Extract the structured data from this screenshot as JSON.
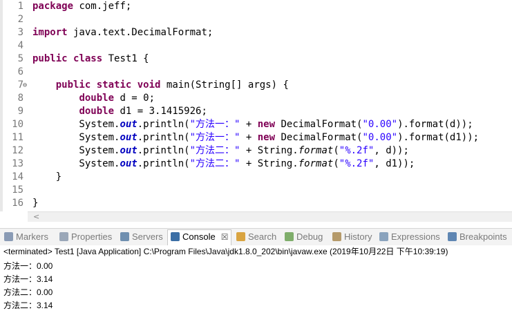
{
  "editor": {
    "lines": [
      {
        "n": "1",
        "tokens": [
          {
            "t": "package",
            "c": "kw"
          },
          {
            "t": " com.jeff;",
            "c": ""
          }
        ]
      },
      {
        "n": "2",
        "tokens": []
      },
      {
        "n": "3",
        "tokens": [
          {
            "t": "import",
            "c": "kw"
          },
          {
            "t": " java.text.DecimalFormat;",
            "c": ""
          }
        ]
      },
      {
        "n": "4",
        "tokens": []
      },
      {
        "n": "5",
        "tokens": [
          {
            "t": "public",
            "c": "kw"
          },
          {
            "t": " ",
            "c": ""
          },
          {
            "t": "class",
            "c": "kw"
          },
          {
            "t": " Test1 {",
            "c": ""
          }
        ]
      },
      {
        "n": "6",
        "tokens": []
      },
      {
        "n": "7",
        "fold": "⊖",
        "tokens": [
          {
            "t": "    ",
            "c": ""
          },
          {
            "t": "public",
            "c": "kw"
          },
          {
            "t": " ",
            "c": ""
          },
          {
            "t": "static",
            "c": "kw"
          },
          {
            "t": " ",
            "c": ""
          },
          {
            "t": "void",
            "c": "kw"
          },
          {
            "t": " main(String[] args) {",
            "c": ""
          }
        ]
      },
      {
        "n": "8",
        "tokens": [
          {
            "t": "        ",
            "c": ""
          },
          {
            "t": "double",
            "c": "kw"
          },
          {
            "t": " d = 0;",
            "c": ""
          }
        ]
      },
      {
        "n": "9",
        "tokens": [
          {
            "t": "        ",
            "c": ""
          },
          {
            "t": "double",
            "c": "kw"
          },
          {
            "t": " d1 = 3.1415926;",
            "c": ""
          }
        ]
      },
      {
        "n": "10",
        "tokens": [
          {
            "t": "        System.",
            "c": ""
          },
          {
            "t": "out",
            "c": "fld"
          },
          {
            "t": ".println(",
            "c": ""
          },
          {
            "t": "\"方法一：\"",
            "c": "str"
          },
          {
            "t": " + ",
            "c": ""
          },
          {
            "t": "new",
            "c": "kw"
          },
          {
            "t": " DecimalFormat(",
            "c": ""
          },
          {
            "t": "\"0.00\"",
            "c": "str"
          },
          {
            "t": ").format(d));",
            "c": ""
          }
        ]
      },
      {
        "n": "11",
        "tokens": [
          {
            "t": "        System.",
            "c": ""
          },
          {
            "t": "out",
            "c": "fld"
          },
          {
            "t": ".println(",
            "c": ""
          },
          {
            "t": "\"方法一：\"",
            "c": "str"
          },
          {
            "t": " + ",
            "c": ""
          },
          {
            "t": "new",
            "c": "kw"
          },
          {
            "t": " DecimalFormat(",
            "c": ""
          },
          {
            "t": "\"0.00\"",
            "c": "str"
          },
          {
            "t": ").format(d1));",
            "c": ""
          }
        ]
      },
      {
        "n": "12",
        "tokens": [
          {
            "t": "        System.",
            "c": ""
          },
          {
            "t": "out",
            "c": "fld"
          },
          {
            "t": ".println(",
            "c": ""
          },
          {
            "t": "\"方法二：\"",
            "c": "str"
          },
          {
            "t": " + String.",
            "c": ""
          },
          {
            "t": "format",
            "c": "st"
          },
          {
            "t": "(",
            "c": ""
          },
          {
            "t": "\"%.2f\"",
            "c": "str"
          },
          {
            "t": ", d));",
            "c": ""
          }
        ]
      },
      {
        "n": "13",
        "tokens": [
          {
            "t": "        System.",
            "c": ""
          },
          {
            "t": "out",
            "c": "fld"
          },
          {
            "t": ".println(",
            "c": ""
          },
          {
            "t": "\"方法二：\"",
            "c": "str"
          },
          {
            "t": " + String.",
            "c": ""
          },
          {
            "t": "format",
            "c": "st"
          },
          {
            "t": "(",
            "c": ""
          },
          {
            "t": "\"%.2f\"",
            "c": "str"
          },
          {
            "t": ", d1));",
            "c": ""
          }
        ]
      },
      {
        "n": "14",
        "tokens": [
          {
            "t": "    }",
            "c": ""
          }
        ]
      },
      {
        "n": "15",
        "tokens": []
      },
      {
        "n": "16",
        "tokens": [
          {
            "t": "}",
            "c": ""
          }
        ]
      }
    ],
    "scroll_arrow": "<"
  },
  "tabs": [
    {
      "label": "Markers",
      "icon": "markers-icon",
      "color": "#8a9bb5"
    },
    {
      "label": "Properties",
      "icon": "properties-icon",
      "color": "#9aa7b8"
    },
    {
      "label": "Servers",
      "icon": "servers-icon",
      "color": "#6f8fb0"
    },
    {
      "label": "Console",
      "icon": "console-icon",
      "color": "#3b6ea5",
      "active": true
    },
    {
      "label": "Search",
      "icon": "search-icon",
      "color": "#d9a441"
    },
    {
      "label": "Debug",
      "icon": "debug-icon",
      "color": "#7fae6b"
    },
    {
      "label": "History",
      "icon": "history-icon",
      "color": "#b59a6a"
    },
    {
      "label": "Expressions",
      "icon": "expressions-icon",
      "color": "#8aa3bd"
    },
    {
      "label": "Breakpoints",
      "icon": "breakpoints-icon",
      "color": "#5f86b3"
    }
  ],
  "console": {
    "header": "<terminated> Test1 [Java Application] C:\\Program Files\\Java\\jdk1.8.0_202\\bin\\javaw.exe (2019年10月22日 下午10:39:19)",
    "output": [
      "方法一：0.00",
      "方法一：3.14",
      "方法二：0.00",
      "方法二：3.14"
    ]
  }
}
